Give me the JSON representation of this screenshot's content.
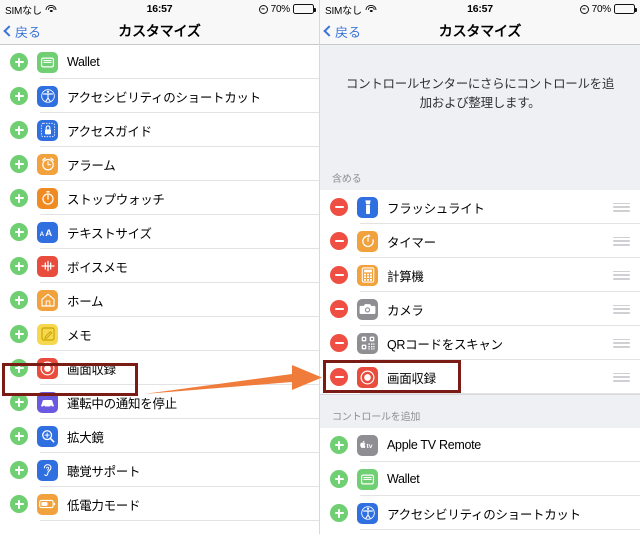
{
  "status_bar": {
    "carrier": "SIMなし",
    "wifi_icon": "wifi-icon",
    "time": "16:57",
    "alarm_icon": "alarm-icon",
    "battery_percent": "70%",
    "battery_level": 70,
    "battery_icon": "battery-icon"
  },
  "nav": {
    "back_label": "戻る",
    "back_icon": "chevron-left-icon",
    "title": "カスタマイズ"
  },
  "colors": {
    "add_green": "#6fcf72",
    "remove_red": "#ef4f42",
    "accent_blue": "#3a74d8",
    "highlight_box": "#7a1b16",
    "arrow_orange": "#f07c3c",
    "group_bg": "#eff0f4"
  },
  "left_screen": {
    "rows": [
      {
        "action": "add",
        "label": "Wallet",
        "icon": "wallet-icon",
        "icon_bg": "#6fcf72"
      },
      {
        "action": "add",
        "label": "アクセシビリティのショートカット",
        "icon": "accessibility-icon",
        "icon_bg": "#2f6fe0"
      },
      {
        "action": "add",
        "label": "アクセスガイド",
        "icon": "guided-access-lock-icon",
        "icon_bg": "#2f6fe0"
      },
      {
        "action": "add",
        "label": "アラーム",
        "icon": "alarm-clock-icon",
        "icon_bg": "#f1a23c"
      },
      {
        "action": "add",
        "label": "ストップウォッチ",
        "icon": "stopwatch-icon",
        "icon_bg": "#ef8b22"
      },
      {
        "action": "add",
        "label": "テキストサイズ",
        "icon": "text-size-icon",
        "icon_bg": "#2f6fe0"
      },
      {
        "action": "add",
        "label": "ボイスメモ",
        "icon": "voice-memo-icon",
        "icon_bg": "#e84c3d"
      },
      {
        "action": "add",
        "label": "ホーム",
        "icon": "home-icon",
        "icon_bg": "#f1a23c"
      },
      {
        "action": "add",
        "label": "メモ",
        "icon": "notes-icon",
        "icon_bg": "#f5d84e"
      },
      {
        "action": "add",
        "label": "画面収録",
        "icon": "screen-record-icon",
        "icon_bg": "#e84c3d",
        "highlighted": true
      },
      {
        "action": "add",
        "label": "運転中の通知を停止",
        "icon": "car-icon",
        "icon_bg": "#6a5ae0"
      },
      {
        "action": "add",
        "label": "拡大鏡",
        "icon": "magnifier-icon",
        "icon_bg": "#2f6fe0"
      },
      {
        "action": "add",
        "label": "聴覚サポート",
        "icon": "hearing-icon",
        "icon_bg": "#2f6fe0"
      },
      {
        "action": "add",
        "label": "低電力モード",
        "icon": "low-power-battery-icon",
        "icon_bg": "#f1a23c"
      }
    ]
  },
  "right_screen": {
    "description": "コントロールセンターにさらにコントロールを追加および整理します。",
    "section_included": "含める",
    "section_more": "コントロールを追加",
    "included_rows": [
      {
        "action": "remove",
        "label": "フラッシュライト",
        "icon": "flashlight-icon",
        "icon_bg": "#2f6fe0",
        "drag": "drag-handle-icon"
      },
      {
        "action": "remove",
        "label": "タイマー",
        "icon": "timer-icon",
        "icon_bg": "#f1a23c",
        "drag": "drag-handle-icon"
      },
      {
        "action": "remove",
        "label": "計算機",
        "icon": "calculator-icon",
        "icon_bg": "#f1a23c",
        "drag": "drag-handle-icon"
      },
      {
        "action": "remove",
        "label": "カメラ",
        "icon": "camera-icon",
        "icon_bg": "#8e8e93",
        "drag": "drag-handle-icon"
      },
      {
        "action": "remove",
        "label": "QRコードをスキャン",
        "icon": "qr-code-icon",
        "icon_bg": "#8e8e93",
        "drag": "drag-handle-icon"
      },
      {
        "action": "remove",
        "label": "画面収録",
        "icon": "screen-record-icon",
        "icon_bg": "#e84c3d",
        "drag": "drag-handle-icon",
        "highlighted": true
      }
    ],
    "more_rows": [
      {
        "action": "add",
        "label": "Apple TV Remote",
        "icon": "apple-tv-icon",
        "icon_bg": "#8e8e93"
      },
      {
        "action": "add",
        "label": "Wallet",
        "icon": "wallet-icon",
        "icon_bg": "#6fcf72"
      },
      {
        "action": "add",
        "label": "アクセシビリティのショートカット",
        "icon": "accessibility-icon",
        "icon_bg": "#2f6fe0"
      }
    ]
  },
  "annotation": {
    "arrow_icon": "arrow-right-annotation",
    "highlight_icon": "highlight-box-annotation"
  }
}
